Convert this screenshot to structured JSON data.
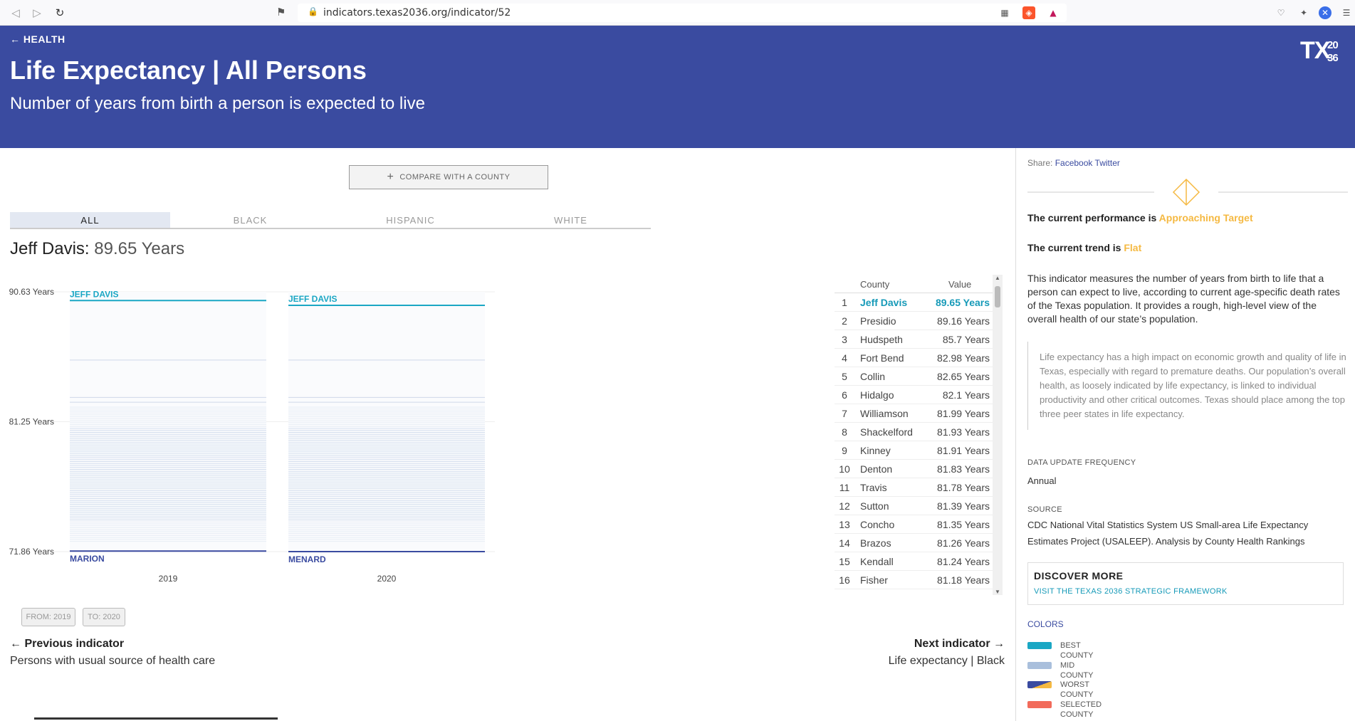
{
  "browser": {
    "url": "indicators.texas2036.org/indicator/52"
  },
  "header": {
    "back_label": "← HEALTH",
    "title": "Life Expectancy | All Persons",
    "subtitle": "Number of years from birth a person is expected to live",
    "logo_text": "TX36"
  },
  "controls": {
    "compare_label": "COMPARE WITH A COUNTY",
    "tabs": [
      "ALL",
      "BLACK",
      "HISPANIC",
      "WHITE"
    ],
    "active_tab": "ALL"
  },
  "selected": {
    "county": "Jeff Davis:",
    "value": "89.65 Years"
  },
  "chart_data": {
    "type": "scatter",
    "y_ticks": [
      "90.63 Years",
      "81.25 Years",
      "71.86 Years"
    ],
    "x_labels": [
      "2019",
      "2020"
    ],
    "best_labels": [
      "JEFF DAVIS",
      "JEFF DAVIS"
    ],
    "worst_labels": [
      "MARION",
      "MENARD"
    ],
    "ylim": [
      71.86,
      90.63
    ],
    "series": [
      {
        "year": "2019",
        "best": 90.0,
        "worst": 71.9
      },
      {
        "year": "2020",
        "best": 89.65,
        "worst": 71.86
      }
    ]
  },
  "table": {
    "headers": [
      "County",
      "Value"
    ],
    "rows": [
      {
        "rank": "1",
        "county": "Jeff Davis",
        "value": "89.65 Years"
      },
      {
        "rank": "2",
        "county": "Presidio",
        "value": "89.16 Years"
      },
      {
        "rank": "3",
        "county": "Hudspeth",
        "value": "85.7 Years"
      },
      {
        "rank": "4",
        "county": "Fort Bend",
        "value": "82.98 Years"
      },
      {
        "rank": "5",
        "county": "Collin",
        "value": "82.65 Years"
      },
      {
        "rank": "6",
        "county": "Hidalgo",
        "value": "82.1 Years"
      },
      {
        "rank": "7",
        "county": "Williamson",
        "value": "81.99 Years"
      },
      {
        "rank": "8",
        "county": "Shackelford",
        "value": "81.93 Years"
      },
      {
        "rank": "9",
        "county": "Kinney",
        "value": "81.91 Years"
      },
      {
        "rank": "10",
        "county": "Denton",
        "value": "81.83 Years"
      },
      {
        "rank": "11",
        "county": "Travis",
        "value": "81.78 Years"
      },
      {
        "rank": "12",
        "county": "Sutton",
        "value": "81.39 Years"
      },
      {
        "rank": "13",
        "county": "Concho",
        "value": "81.35 Years"
      },
      {
        "rank": "14",
        "county": "Brazos",
        "value": "81.26 Years"
      },
      {
        "rank": "15",
        "county": "Kendall",
        "value": "81.24 Years"
      },
      {
        "rank": "16",
        "county": "Fisher",
        "value": "81.18 Years"
      }
    ]
  },
  "range": {
    "from": "FROM: 2019",
    "to": "TO: 2020"
  },
  "pagination": {
    "prev_label": "← Previous indicator",
    "prev_name": "Persons with usual source of health care",
    "next_label": "Next indicator →",
    "next_name": "Life expectancy | Black"
  },
  "side": {
    "share_label": "Share:",
    "share_links": [
      "Facebook",
      "Twitter"
    ],
    "performance_prefix": "The current performance is ",
    "performance_value": "Approaching Target",
    "trend_prefix": "The current trend is ",
    "trend_value": "Flat",
    "description": "This indicator measures the number of years from birth to life that a person can expect to live, according to current age-specific death rates of the Texas population. It provides a rough, high-level view of the overall health of our state’s population.",
    "quote": "Life expectancy has a high impact on economic growth and quality of life in Texas, especially with regard to premature deaths. Our population’s overall health, as loosely indicated by life expectancy, is linked to individual productivity and other critical outcomes. Texas should place among the top three peer states in life expectancy.",
    "frequency_label": "DATA UPDATE FREQUENCY",
    "frequency_value": "Annual",
    "source_label": "SOURCE",
    "source_value": "CDC National Vital Statistics System US Small-area Life Expectancy Estimates Project (USALEEP). Analysis by County Health Rankings",
    "discover_title": "DISCOVER MORE",
    "discover_link": "VISIT THE TEXAS 2036 STRATEGIC FRAMEWORK",
    "colors_title": "COLORS",
    "legend": [
      {
        "label": "BEST COUNTY",
        "color": "#1aa7c4"
      },
      {
        "label": "MID COUNTY",
        "color": "#a9bfdc"
      },
      {
        "label": "WORST COUNTY",
        "color": "#3a4ba0"
      },
      {
        "label": "SELECTED COUNTY",
        "color": "#f26b5b"
      }
    ],
    "accent_color": "#f5b942"
  }
}
